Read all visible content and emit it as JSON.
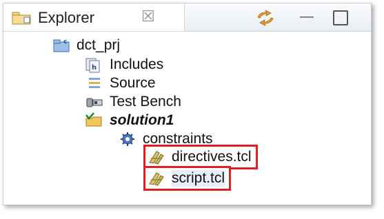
{
  "explorer": {
    "title": "Explorer",
    "close_glyph": "☒",
    "minimize_glyph": "—",
    "tree": {
      "project": "dct_prj",
      "includes": "Includes",
      "source": "Source",
      "test_bench": "Test Bench",
      "solution": "solution1",
      "constraints": "constraints",
      "directives": "directives.tcl",
      "script": "script.tcl"
    },
    "highlight_color": "#e02020"
  }
}
